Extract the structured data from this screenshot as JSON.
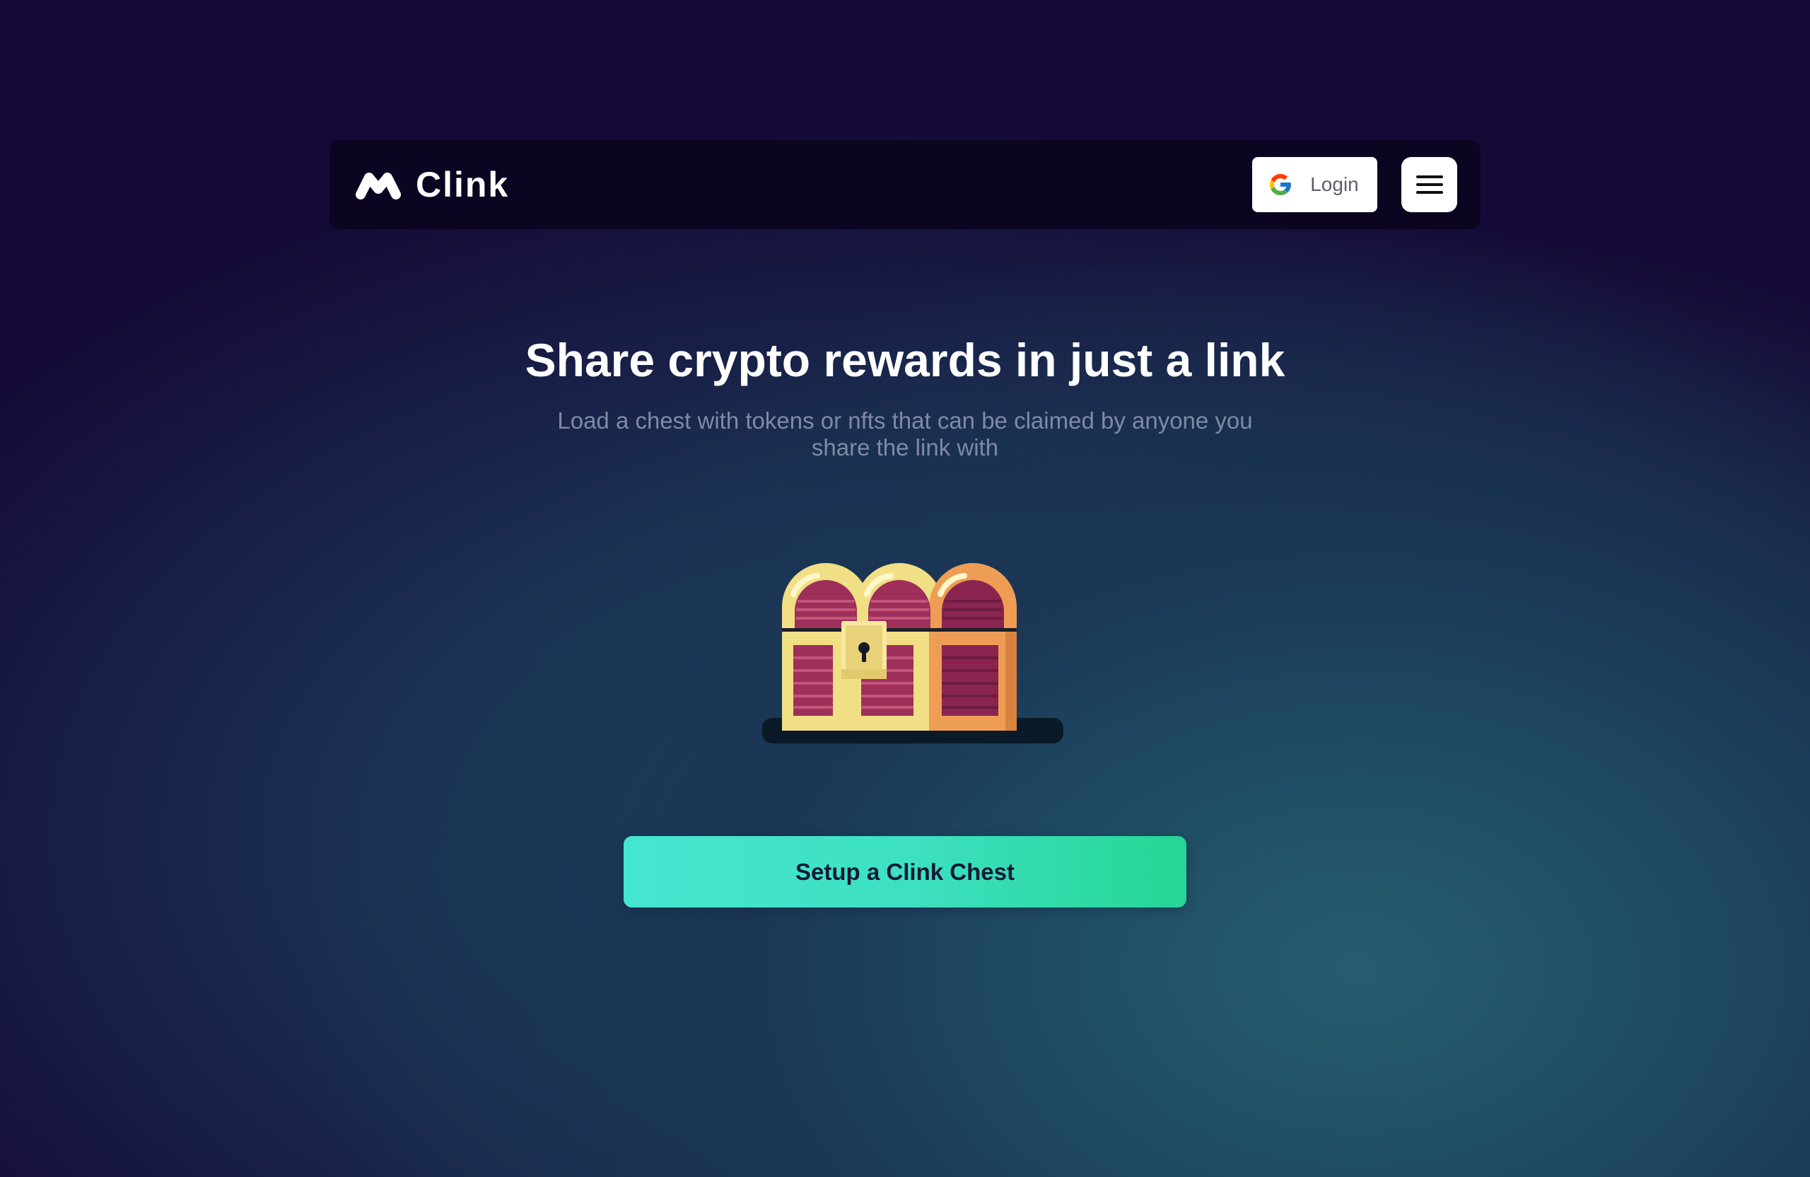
{
  "app": {
    "name": "Clink",
    "logo_icon": "clink-logo-icon"
  },
  "header": {
    "login_label": "Login",
    "login_icon": "google-icon",
    "menu_icon": "hamburger-menu-icon"
  },
  "hero": {
    "title": "Share crypto rewards in just a link",
    "subtitle": "Load a chest with tokens or nfts that can be claimed by anyone you share the link with",
    "illustration": "treasure-chest-icon",
    "cta_label": "Setup a Clink Chest"
  },
  "colors": {
    "page_background": "#150a37",
    "navbar_background": "#0b0521",
    "cta_gradient_start": "#45e6d0",
    "cta_gradient_end": "#25d694",
    "subtitle_text": "#7f8aa4"
  }
}
